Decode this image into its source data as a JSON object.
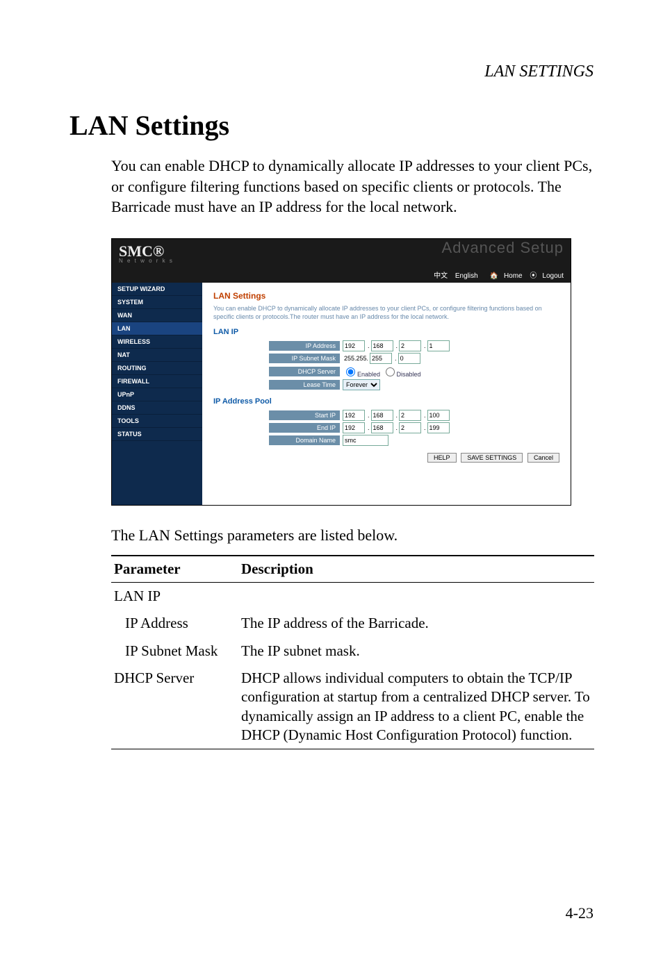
{
  "page_header": "LAN SETTINGS",
  "heading": "LAN Settings",
  "intro": "You can enable DHCP to dynamically allocate IP addresses to your client PCs, or configure filtering functions based on specific clients or protocols. The Barricade must have an IP address for the local network.",
  "caption": "The LAN Settings parameters are listed below.",
  "page_number": "4-23",
  "screenshot": {
    "logo": "SMC®",
    "logo_sub": "N e t w o r k s",
    "advanced": "Advanced Setup",
    "topbar": {
      "cn": "中文",
      "en": "English",
      "home": "Home",
      "logout": "Logout"
    },
    "sidebar": [
      "SETUP WIZARD",
      "SYSTEM",
      "WAN",
      "LAN",
      "WIRELESS",
      "NAT",
      "ROUTING",
      "FIREWALL",
      "UPnP",
      "DDNS",
      "TOOLS",
      "STATUS"
    ],
    "content": {
      "title": "LAN Settings",
      "desc": "You can enable DHCP to dynamically allocate IP addresses to your client PCs, or configure filtering functions based on specific clients or protocols.The router must have an IP address for the local network.",
      "section_lanip": "LAN IP",
      "labels": {
        "ip_address": "IP Address",
        "ip_subnet": "IP Subnet Mask",
        "dhcp_server": "DHCP Server",
        "lease_time": "Lease Time",
        "start_ip": "Start IP",
        "end_ip": "End IP",
        "domain_name": "Domain Name"
      },
      "values": {
        "ip": [
          "192",
          "168",
          "2",
          "1"
        ],
        "subnet_prefix": "255.255.",
        "subnet": [
          "255",
          "0"
        ],
        "dhcp_enabled": "Enabled",
        "dhcp_disabled": "Disabled",
        "lease": "Forever",
        "start_ip": [
          "192",
          "168",
          "2",
          "100"
        ],
        "end_ip": [
          "192",
          "168",
          "2",
          "199"
        ],
        "domain": "smc"
      },
      "section_pool": "IP Address Pool",
      "buttons": {
        "help": "HELP",
        "save": "SAVE SETTINGS",
        "cancel": "Cancel"
      }
    }
  },
  "table": {
    "head_param": "Parameter",
    "head_desc": "Description",
    "rows": [
      {
        "param": "LAN IP",
        "desc": "",
        "indent": false
      },
      {
        "param": "IP Address",
        "desc": "The IP address of the Barricade.",
        "indent": true
      },
      {
        "param": "IP Subnet Mask",
        "desc": "The IP subnet mask.",
        "indent": true
      },
      {
        "param": "DHCP Server",
        "desc": "DHCP allows individual computers to obtain the TCP/IP configuration at startup from a centralized DHCP server. To dynamically assign an IP address to a client PC, enable the DHCP (Dynamic Host Configuration Protocol) function.",
        "indent": false
      }
    ]
  }
}
